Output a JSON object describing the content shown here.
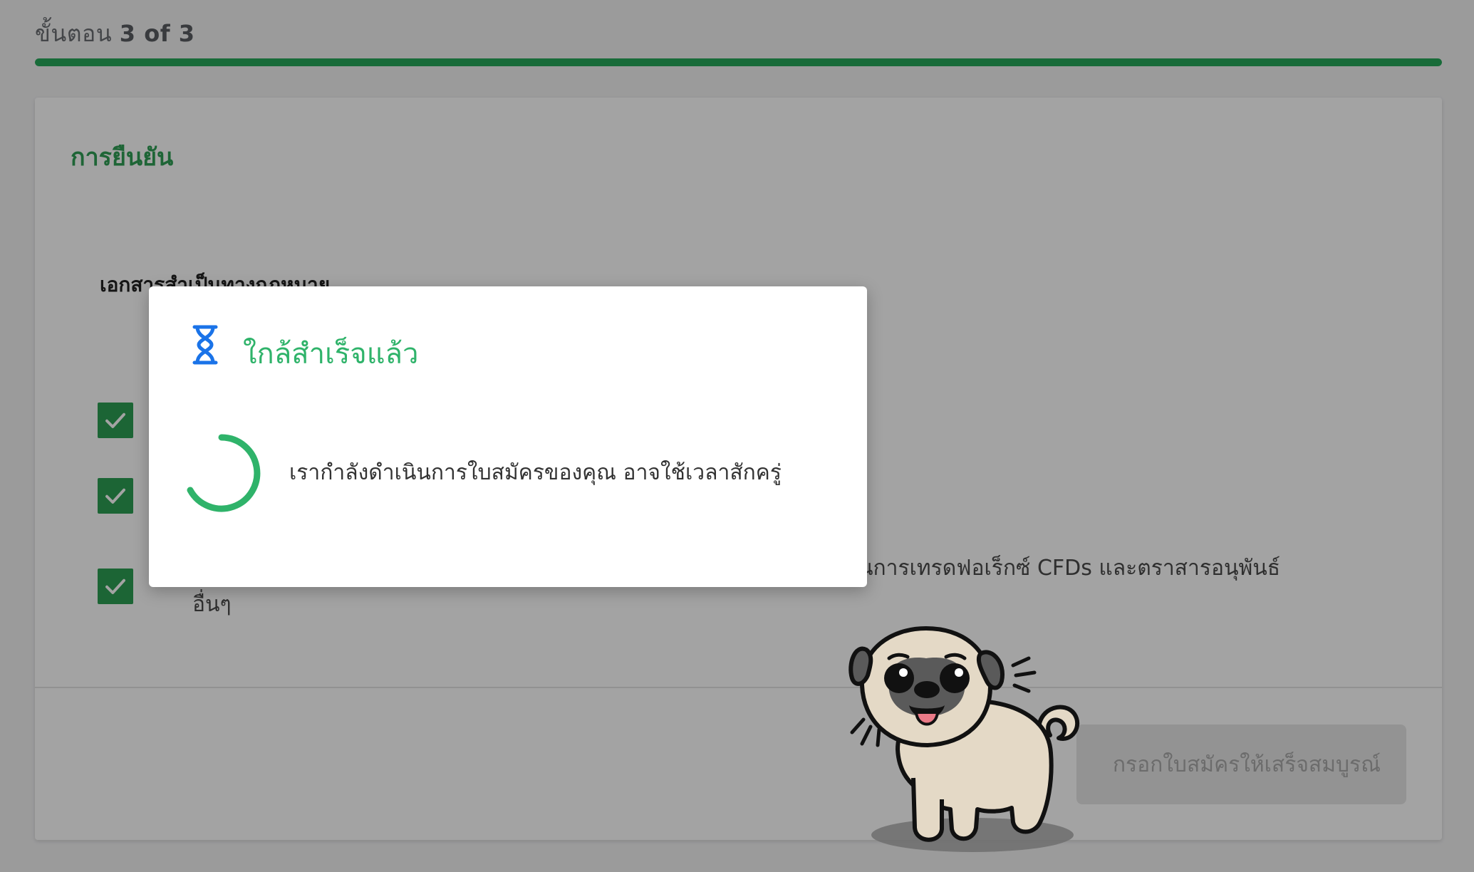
{
  "step": {
    "prefix": "ขั้นตอน",
    "current_of_total": "3 of 3",
    "progress_percent": 100,
    "progress_color": "#27a85a"
  },
  "card": {
    "title": "การยืนยัน",
    "section_heading": "เอกสารสำเป็นทางกฎหมาย",
    "items": [
      {
        "checked": true,
        "text": ""
      },
      {
        "checked": true,
        "text": ""
      },
      {
        "checked": true,
        "text": "นการเทรดฟอเร็กซ์ CFDs และตราสารอนุพันธ์",
        "text_line2": "อื่นๆ"
      }
    ]
  },
  "footer": {
    "submit_label": "กรอกใบสมัครให้เสร็จสมบูรณ์"
  },
  "modal": {
    "icon": "hourglass-icon",
    "title": "ใกล้สำเร็จแล้ว",
    "message": "เรากำลังดำเนินการใบสมัครของคุณ อาจใช้เวลาสักครู่",
    "accent_color": "#2fb36a",
    "icon_color": "#1a73e8"
  },
  "mascot": {
    "name": "pug-illustration"
  }
}
